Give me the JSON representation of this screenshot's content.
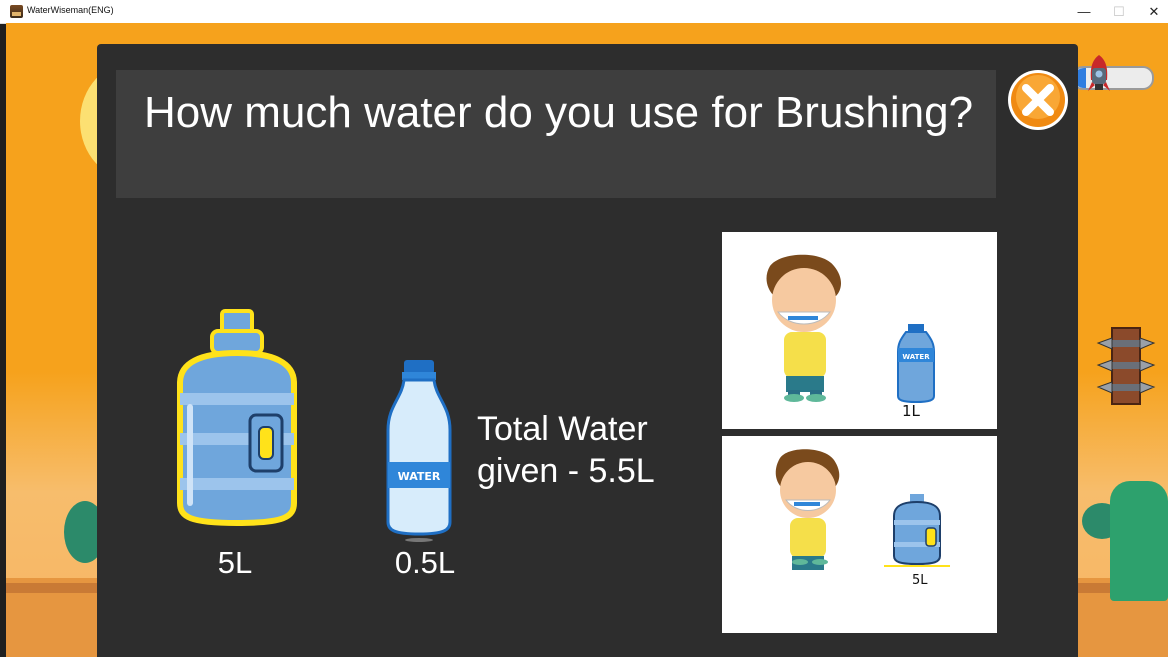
{
  "window": {
    "title": "WaterWiseman(ENG)",
    "minimize_glyph": "—",
    "maximize_glyph": "☐",
    "close_glyph": "✕"
  },
  "game": {
    "progress": 0.15,
    "accent_color": "#f6a21c",
    "popup": {
      "question": "How much water do you use for Brushing?",
      "close_icon": "close-x-icon",
      "bottles": [
        {
          "icon": "water-jug-icon",
          "amount": "5L"
        },
        {
          "icon": "water-bottle-icon",
          "amount": "0.5L"
        }
      ],
      "total_line1": "Total Water",
      "total_line2": "given - 5.5L",
      "options": [
        {
          "image": "boy-brushing-with-bottle",
          "amount": "1L",
          "bottle_text": "WATER"
        },
        {
          "image": "boy-brushing-with-jug",
          "amount": "5L"
        }
      ]
    }
  }
}
